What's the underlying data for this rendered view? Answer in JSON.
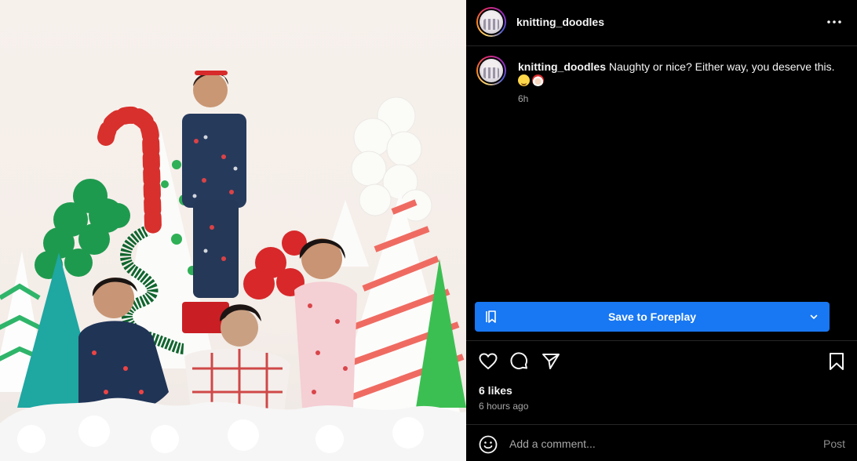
{
  "post": {
    "username": "knitting_doodles",
    "more_icon": "more-horizontal-icon",
    "photo_icon": "post-photo"
  },
  "caption": {
    "username": "knitting_doodles",
    "text": "Naughty or nice? Either way, you deserve this.",
    "emojis": [
      "wink-emoji",
      "santa-emoji"
    ],
    "time": "6h"
  },
  "save_button": {
    "label": "Save to Foreplay",
    "icon": "bookmark-icon",
    "chevron": "chevron-down-icon",
    "color": "#1877f2"
  },
  "actions": {
    "like": "heart-icon",
    "comment": "comment-icon",
    "share": "send-icon",
    "save": "bookmark-icon"
  },
  "stats": {
    "likes": "6 likes",
    "posted": "6 hours ago"
  },
  "comment_box": {
    "placeholder": "Add a comment...",
    "post_label": "Post",
    "emoji_icon": "smiley-icon"
  }
}
